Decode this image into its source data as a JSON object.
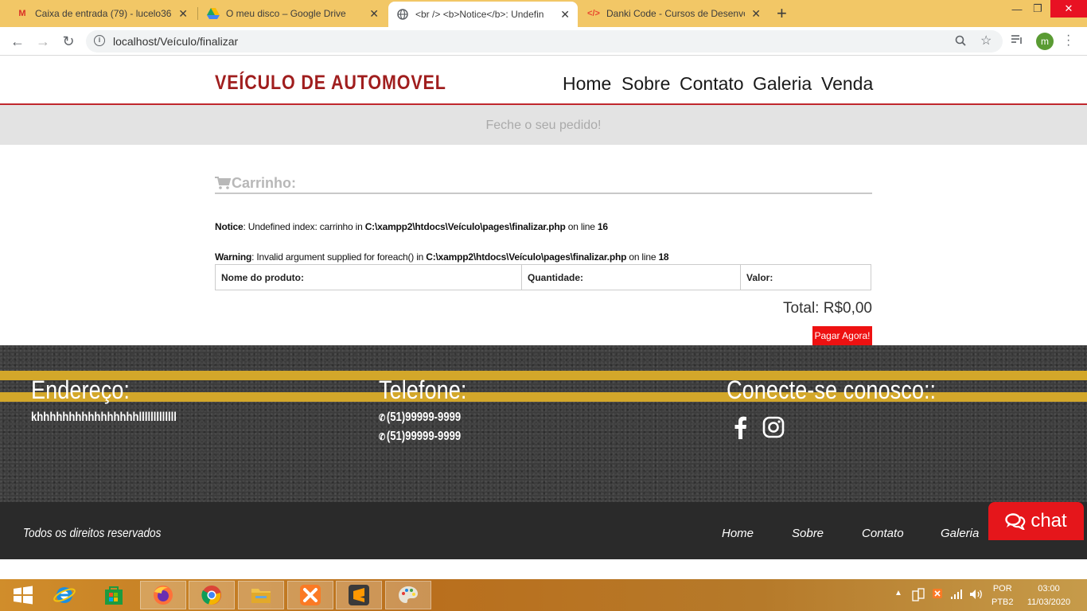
{
  "browser": {
    "tabs": [
      {
        "title": "Caixa de entrada (79) - lucelo361",
        "icon": "gmail-icon"
      },
      {
        "title": "O meu disco – Google Drive",
        "icon": "google-drive-icon"
      },
      {
        "title": "<br /> <b>Notice</b>: Undefin",
        "icon": "globe-icon"
      },
      {
        "title": "Danki Code - Cursos de Desenvo",
        "icon": "code-icon"
      }
    ],
    "active_tab": 2,
    "url": "localhost/Veículo/finalizar",
    "avatar_letter": "m"
  },
  "site": {
    "logo": "VEÍCULO DE AUTOMOVEL",
    "nav": [
      "Home",
      "Sobre",
      "Contato",
      "Galeria",
      "Venda"
    ],
    "banner": "Feche o seu pedido!"
  },
  "cart": {
    "title": "Carrinho:",
    "notice": {
      "label": "Notice",
      "text": ": Undefined index: carrinho in ",
      "path": "C:\\xampp2\\htdocs\\Veículo\\pages\\finalizar.php",
      "line_text": " on line ",
      "line": "16"
    },
    "warning": {
      "label": "Warning",
      "text": ": Invalid argument supplied for foreach() in ",
      "path": "C:\\xampp2\\htdocs\\Veículo\\pages\\finalizar.php",
      "line_text": " on line ",
      "line": "18"
    },
    "columns": [
      "Nome do produto:",
      "Quantidade:",
      "Valor:"
    ],
    "total": "Total: R$0,00",
    "pay_button": "Pagar Agora!"
  },
  "footer": {
    "address_title": "Endereço:",
    "address_text": "khhhhhhhhhhhhhhhhlllllllllllll",
    "phone_title": "Telefone:",
    "phones": [
      "(51)99999-9999",
      "(51)99999-9999"
    ],
    "social_title": "Conecte-se conosco::",
    "copyright": "Todos os direitos reservados",
    "nav": [
      "Home",
      "Sobre",
      "Contato",
      "Galeria"
    ],
    "chat": "chat"
  },
  "taskbar": {
    "language": "POR",
    "layout": "PTB2",
    "time": "03:00",
    "date": "11/03/2020"
  },
  "colors": {
    "brand_red": "#c0272d",
    "logo_red": "#a01e1e",
    "pay_red": "#ee1111",
    "chat_red": "#e5161b",
    "road": "#3b3b3b",
    "road_stripe": "#d3a72a"
  }
}
